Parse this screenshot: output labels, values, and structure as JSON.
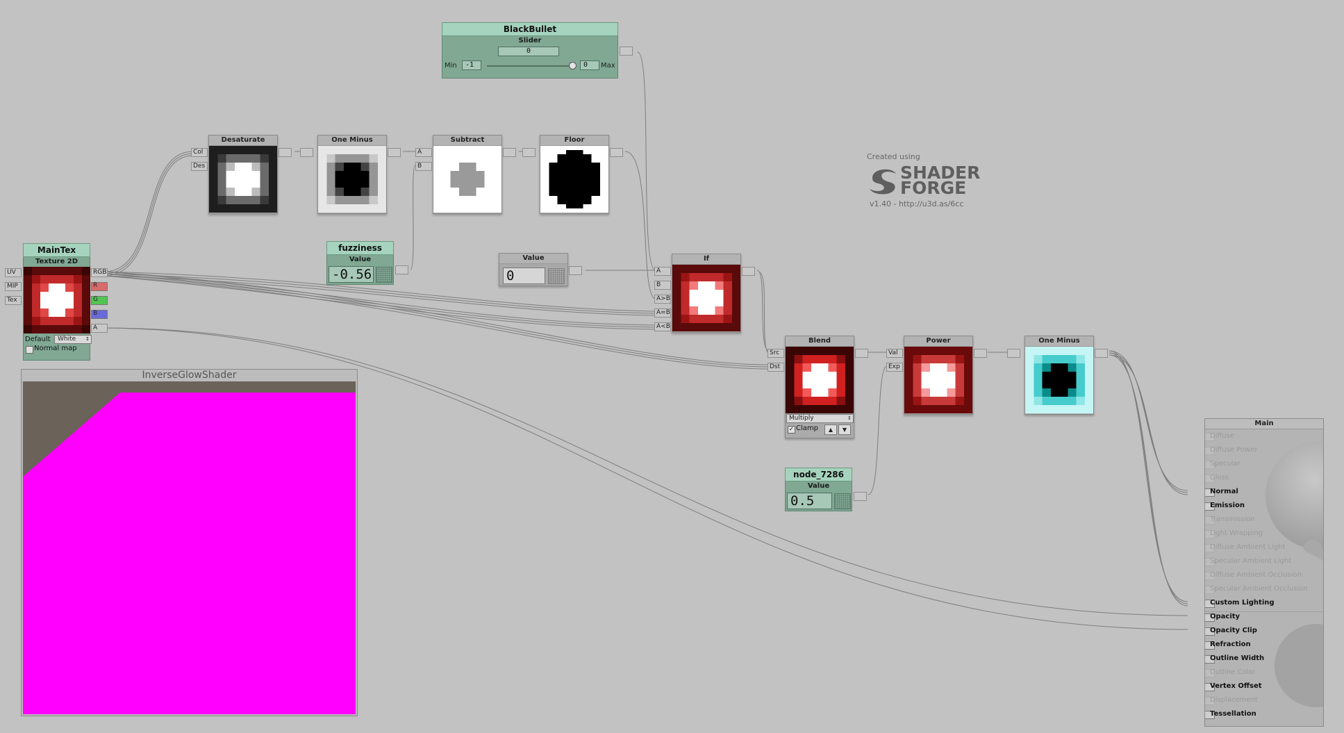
{
  "logo": {
    "created_using": "Created using",
    "brand_top": "SHADER",
    "brand_bottom": "FORGE",
    "version": "v1.40 - http://u3d.as/6cc"
  },
  "blackbullet": {
    "title": "BlackBullet",
    "subtitle": "Slider",
    "value": "0",
    "min_label": "Min",
    "min_value": "-1",
    "max_value": "0",
    "max_label": "Max"
  },
  "maintex": {
    "title": "MainTex",
    "subtitle": "Texture 2D",
    "inputs": [
      "UV",
      "MIP",
      "Tex"
    ],
    "outputs": [
      "RGB",
      "R",
      "G",
      "B",
      "A"
    ],
    "default_label": "Default",
    "default_value": "White",
    "normal_map_label": "Normal map",
    "normal_map_checked": false
  },
  "desaturate": {
    "title": "Desaturate",
    "inputs": [
      "Col",
      "Des"
    ]
  },
  "oneminus1": {
    "title": "One Minus"
  },
  "subtract": {
    "title": "Subtract",
    "inputs": [
      "A",
      "B"
    ]
  },
  "floor": {
    "title": "Floor"
  },
  "fuzziness": {
    "title": "fuzziness",
    "subtitle": "Value",
    "value": "-0.56"
  },
  "value0": {
    "title": "Value",
    "value": "0"
  },
  "if_node": {
    "title": "If",
    "inputs": [
      "A",
      "B",
      "A>B",
      "A=B",
      "A<B"
    ]
  },
  "blend": {
    "title": "Blend",
    "inputs": [
      "Src",
      "Dst"
    ],
    "mode": "Multiply",
    "clamp_label": "Clamp",
    "clamp_checked": true
  },
  "power": {
    "title": "Power",
    "inputs": [
      "Val",
      "Exp"
    ]
  },
  "oneminus2": {
    "title": "One Minus"
  },
  "node7286": {
    "title": "node_7286",
    "subtitle": "Value",
    "value": "0.5"
  },
  "preview": {
    "title": "InverseGlowShader",
    "colors": {
      "magenta": "#ff00ff",
      "backdrop": "#6b6259"
    }
  },
  "main": {
    "title": "Main",
    "inputs": [
      {
        "label": "Diffuse",
        "enabled": false
      },
      {
        "label": "Diffuse Power",
        "enabled": false
      },
      {
        "label": "Specular",
        "enabled": false
      },
      {
        "label": "Gloss",
        "enabled": false
      },
      {
        "label": "Normal",
        "enabled": true
      },
      {
        "label": "Emission",
        "enabled": true
      },
      {
        "label": "Transmission",
        "enabled": false
      },
      {
        "label": "Light Wrapping",
        "enabled": false
      },
      {
        "label": "Diffuse Ambient Light",
        "enabled": false
      },
      {
        "label": "Specular Ambient Light",
        "enabled": false
      },
      {
        "label": "Diffuse Ambient Occlusion",
        "enabled": false
      },
      {
        "label": "Specular Ambient Occlusion",
        "enabled": false
      },
      {
        "label": "Custom Lighting",
        "enabled": true
      },
      {
        "label": "Opacity",
        "enabled": true
      },
      {
        "label": "Opacity Clip",
        "enabled": true
      },
      {
        "label": "Refraction",
        "enabled": true
      },
      {
        "label": "Outline Width",
        "enabled": true
      },
      {
        "label": "Outline Color",
        "enabled": false
      },
      {
        "label": "Vertex Offset",
        "enabled": true
      },
      {
        "label": "Displacement",
        "enabled": false
      },
      {
        "label": "Tessellation",
        "enabled": true
      }
    ]
  },
  "colors": {
    "param_header": "#a6d3bd",
    "param_body": "#80a893",
    "canvas": "#c2c2c2",
    "wire": "#7a7a7a"
  }
}
